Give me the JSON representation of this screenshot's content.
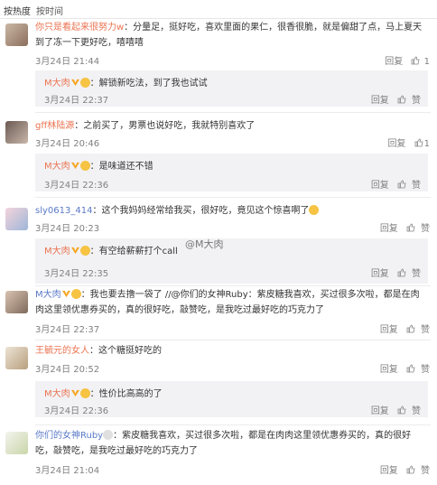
{
  "tabs": [
    "按热度",
    "按时间"
  ],
  "reply_label": "回复",
  "like_label": "赞",
  "watermark": "@M大肉",
  "comments": [
    {
      "user": "你只是看起来很努力w",
      "text": "：分量足，挺好吃，喜欢里面的果仁，很香很脆，就是偏甜了点，马上夏天到了冻一下更好吃，嘻嘻嘻",
      "time": "3月24日 21:44",
      "likes": "1",
      "reply": {
        "user": "M大肉",
        "text": "：解锁新吃法，到了我也试试",
        "time": "3月24日 22:37"
      }
    },
    {
      "user": "gff林陆源",
      "text": "：之前买了，男票也说好吃，我就特别喜欢了",
      "time": "3月24日 20:46",
      "likes": "1",
      "reply": {
        "user": "M大肉",
        "text": "：是味道还不错",
        "time": "3月24日 22:36"
      }
    },
    {
      "user": "sly0613_414",
      "text": "：这个我妈妈经常给我买，很好吃，竟见这个惊喜啊了",
      "time": "3月24日 20:23",
      "likes": "",
      "reply": {
        "user": "M大肉",
        "text": "：有空给薪薪打个call",
        "time": "3月24日 22:35"
      }
    },
    {
      "user": "M大肉",
      "text": "：我也要去撸一袋了 //@你们的女神Ruby：紫皮糖我喜欢，买过很多次啦，都是在肉肉这里领优惠券买的，真的很好吃，敲赞吃，是我吃过最好吃的巧克力了",
      "time": "3月24日 22:37",
      "likes": "",
      "reply": null
    },
    {
      "user": "王毓元的女人",
      "text": "：这个糖挺好吃的",
      "time": "3月24日 20:52",
      "likes": "",
      "reply": {
        "user": "M大肉",
        "text": "：性价比高高的了",
        "time": "3月24日 22:36"
      }
    },
    {
      "user": "你们的女神Ruby",
      "text": "：紫皮糖我喜欢，买过很多次啦，都是在肉肉这里领优惠券买的，真的很好吃，敲赞吃，是我吃过最好吃的巧克力了",
      "time": "3月24日 21:04",
      "likes": "",
      "reply": null
    }
  ]
}
